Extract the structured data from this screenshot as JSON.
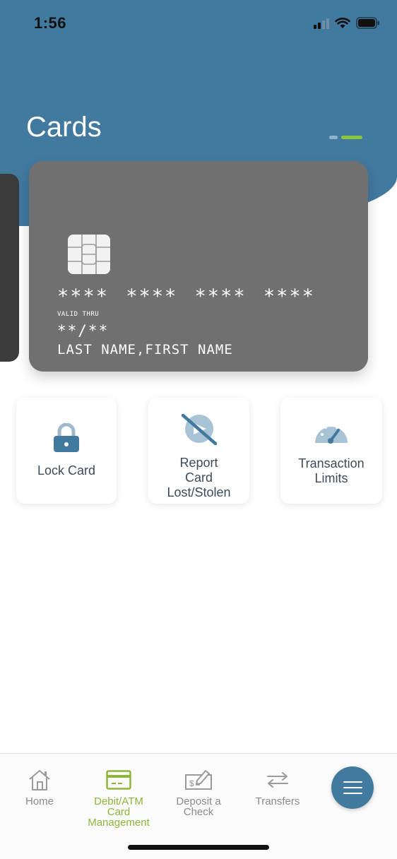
{
  "status_bar": {
    "time": "1:56"
  },
  "header": {
    "title": "Cards",
    "pager": {
      "total": 2,
      "active_index": 1
    }
  },
  "card": {
    "number": "**** **** **** ****",
    "valid_thru_label": "VALID THRU",
    "expiry": "**/**",
    "name": "LAST NAME,FIRST NAME",
    "color": "#707070"
  },
  "actions": [
    {
      "label_lines": [
        "Lock Card"
      ],
      "icon": "lock-icon"
    },
    {
      "label_lines": [
        "Report",
        "Card",
        "Lost/Stolen"
      ],
      "icon": "lost-card-icon"
    },
    {
      "label_lines": [
        "Transaction",
        "Limits"
      ],
      "icon": "gauge-icon"
    }
  ],
  "bottom_nav": {
    "items": [
      {
        "label_lines": [
          "Home"
        ],
        "icon": "home-icon",
        "active": false
      },
      {
        "label_lines": [
          "Debit/ATM",
          "Card",
          "Management"
        ],
        "icon": "credit-card-icon",
        "active": true
      },
      {
        "label_lines": [
          "Deposit a",
          "Check"
        ],
        "icon": "check-deposit-icon",
        "active": false
      },
      {
        "label_lines": [
          "Transfers"
        ],
        "icon": "transfer-arrows-icon",
        "active": false
      }
    ],
    "menu_icon": "hamburger-menu-icon"
  },
  "colors": {
    "brand_blue": "#42799f",
    "accent_green": "#8cc63f",
    "nav_active": "#8cb53a",
    "nav_inactive": "#8b8b8b",
    "tile_text": "#3d4a57"
  }
}
